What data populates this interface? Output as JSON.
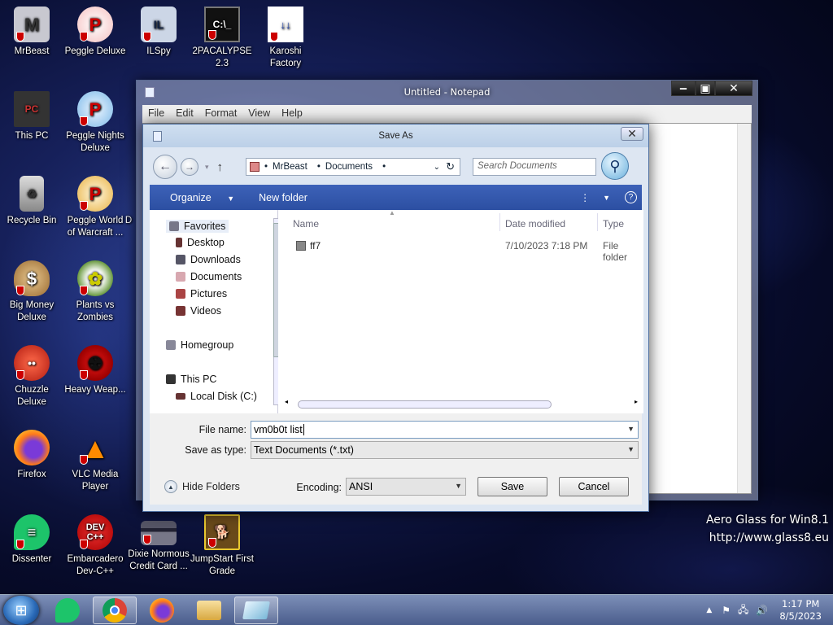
{
  "desktop": {
    "icons": [
      {
        "label": "MrBeast"
      },
      {
        "label": "Peggle Deluxe"
      },
      {
        "label": "ILSpy"
      },
      {
        "label": "2PACALYPSE 2.3"
      },
      {
        "label": "Karoshi Factory"
      },
      {
        "label": "This PC"
      },
      {
        "label": "Peggle Nights Deluxe"
      },
      {
        "label": "Recycle Bin"
      },
      {
        "label": "Peggle World of Warcraft ..."
      },
      {
        "label": "D"
      },
      {
        "label": "Big Money Deluxe"
      },
      {
        "label": "Plants vs Zombies"
      },
      {
        "label": "Chuzzle Deluxe"
      },
      {
        "label": "Heavy Weap..."
      },
      {
        "label": "Firefox"
      },
      {
        "label": "VLC Media Player"
      },
      {
        "label": "Dissenter"
      },
      {
        "label": "Embarcadero Dev-C++"
      },
      {
        "label": "Dixie Normous Credit Card ..."
      },
      {
        "label": "JumpStart First Grade"
      }
    ],
    "watermark_line1": "Aero Glass for Win8.1",
    "watermark_line2": "http://www.glass8.eu"
  },
  "notepad": {
    "title": "Untitled - Notepad",
    "menu": [
      "File",
      "Edit",
      "Format",
      "View",
      "Help"
    ]
  },
  "save_dialog": {
    "title": "Save As",
    "breadcrumb": [
      "MrBeast",
      "Documents"
    ],
    "search_placeholder": "Search Documents",
    "organize_label": "Organize",
    "new_folder_label": "New folder",
    "nav": {
      "favorites": "Favorites",
      "desktop": "Desktop",
      "downloads": "Downloads",
      "documents": "Documents",
      "pictures": "Pictures",
      "videos": "Videos",
      "homegroup": "Homegroup",
      "this_pc": "This PC",
      "local_disk": "Local Disk (C:)"
    },
    "columns": {
      "name": "Name",
      "date": "Date modified",
      "type": "Type"
    },
    "files": [
      {
        "name": "ff7",
        "date": "7/10/2023 7:18 PM",
        "type": "File folder"
      }
    ],
    "file_name_label": "File name:",
    "file_name_value": "vm0b0t list",
    "save_type_label": "Save as type:",
    "save_type_value": "Text Documents (*.txt)",
    "hide_folders_label": "Hide Folders",
    "encoding_label": "Encoding:",
    "encoding_value": "ANSI",
    "save_label": "Save",
    "cancel_label": "Cancel"
  },
  "taskbar": {
    "time": "1:17 PM",
    "date": "8/5/2023"
  }
}
